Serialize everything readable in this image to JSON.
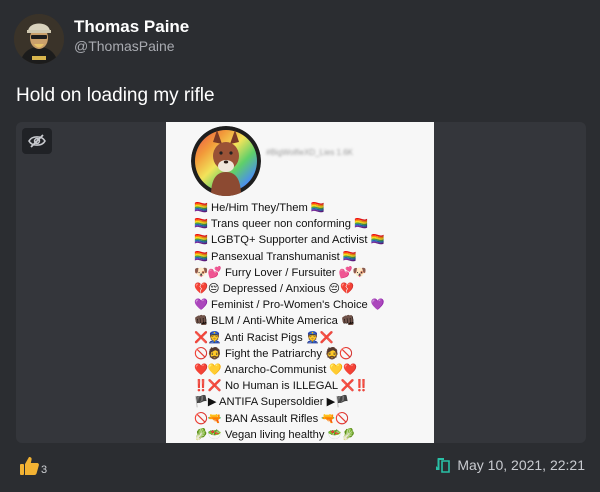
{
  "author": {
    "name": "Thomas Paine",
    "handle": "@ThomasPaine"
  },
  "post": {
    "text": "Hold on loading my rifle"
  },
  "media": {
    "hidden_toggle_icon": "eye-slash-icon",
    "screenshot": {
      "bio_lines": [
        "🏳️‍🌈 He/Him They/Them 🏳️‍🌈",
        "🏳️‍🌈 Trans queer non conforming 🏳️‍🌈",
        "🏳️‍🌈 LGBTQ+ Supporter and Activist 🏳️‍🌈",
        "🏳️‍🌈 Pansexual Transhumanist 🏳️‍🌈",
        "🐶💕 Furry Lover / Fursuiter 💕🐶",
        "💔😔 Depressed / Anxious 😔💔",
        "💜 Feminist / Pro-Women's Choice 💜",
        "👊🏿 BLM / Anti-White America 👊🏿",
        "❌👮 Anti Racist Pigs 👮❌",
        "🚫🧔 Fight the Patriarchy 🧔🚫",
        "❤️💛 Anarcho-Communist 💛❤️",
        "‼️❌ No Human is ILLEGAL ❌‼️",
        "🏴▶ ANTIFA Supersoldier ▶🏴",
        "🚫🔫 BAN Assault Rifles 🔫🚫",
        "🥬🥗 Vegan living healthy 🥗🥬"
      ]
    }
  },
  "footer": {
    "like_icon": "thumbs-up-icon",
    "like_count": "3",
    "link_icon": "external-link-icon",
    "timestamp": "May 10, 2021, 22:21"
  },
  "colors": {
    "background": "#2b2d31",
    "media_background": "#34363b",
    "like_icon": "#f2b233",
    "link_icon": "#29c0a6"
  }
}
